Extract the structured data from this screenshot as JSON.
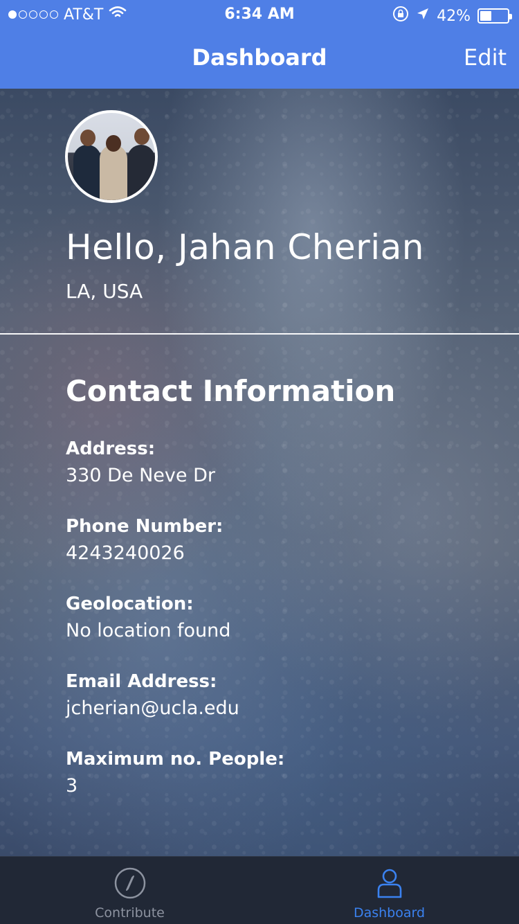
{
  "status_bar": {
    "signal_dots_filled": 1,
    "signal_dots_total": 5,
    "carrier": "AT&T",
    "time": "6:34 AM",
    "battery_percent": "42%",
    "battery_level": 0.42
  },
  "navbar": {
    "title": "Dashboard",
    "edit_label": "Edit",
    "color": "#4f7fe6"
  },
  "profile": {
    "greeting": "Hello, Jahan Cherian",
    "location": "LA, USA"
  },
  "contact": {
    "section_title": "Contact Information",
    "fields": [
      {
        "label": "Address:",
        "value": "330 De Neve Dr"
      },
      {
        "label": "Phone Number:",
        "value": "4243240026"
      },
      {
        "label": "Geolocation:",
        "value": "No location found"
      },
      {
        "label": "Email Address:",
        "value": "jcherian@ucla.edu"
      },
      {
        "label": "Maximum no. People:",
        "value": "3"
      }
    ]
  },
  "tabbar": {
    "items": [
      {
        "label": "Contribute",
        "icon": "compass-icon",
        "active": false
      },
      {
        "label": "Dashboard",
        "icon": "person-icon",
        "active": true
      }
    ],
    "active_color": "#3b82f0",
    "inactive_color": "#8d93a0"
  }
}
